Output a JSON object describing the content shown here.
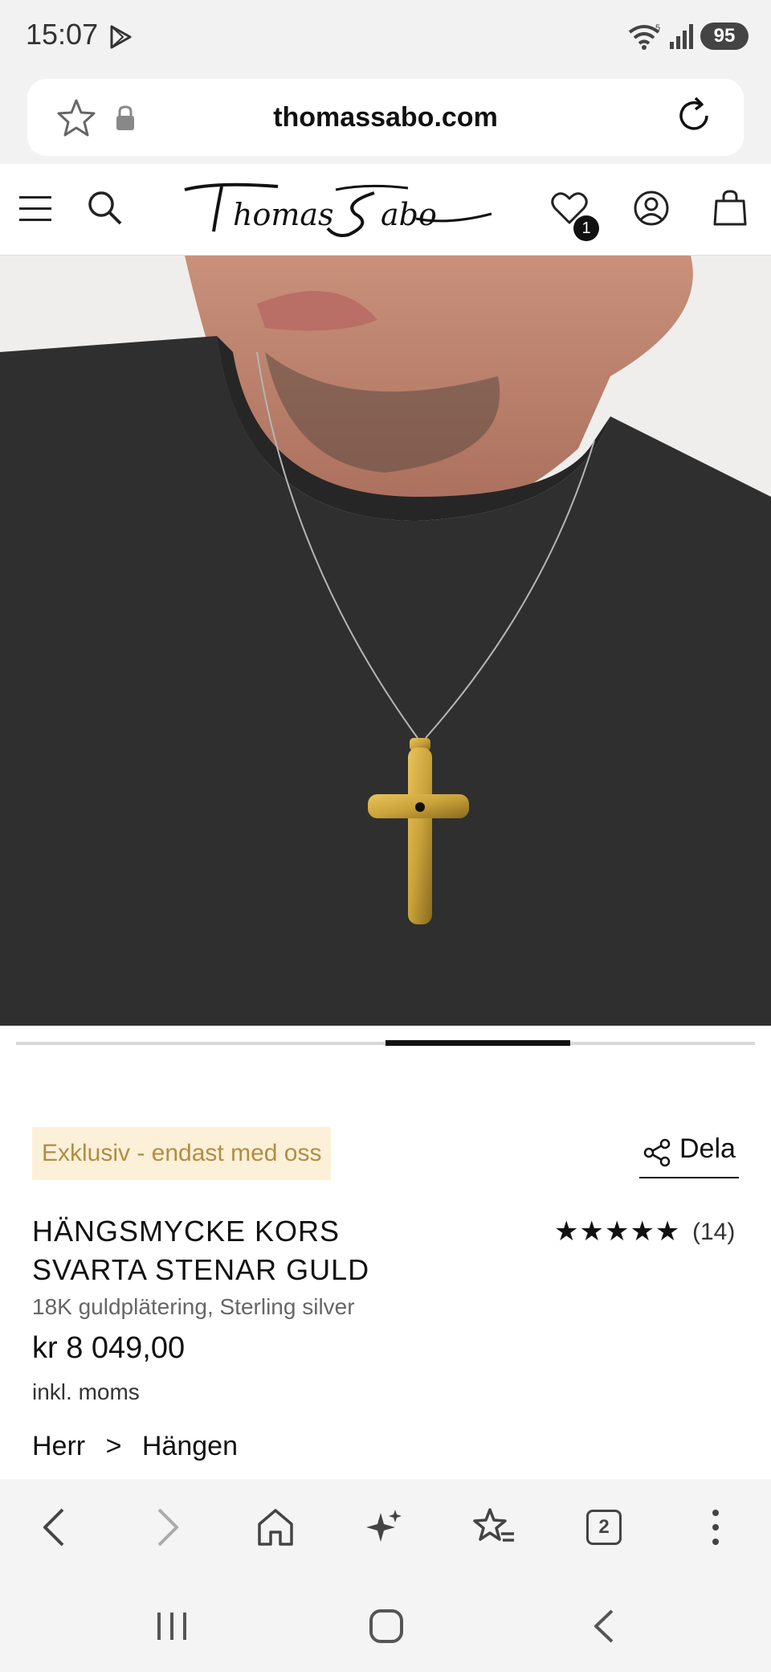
{
  "status_bar": {
    "time": "15:07",
    "battery": "95",
    "icons": [
      "play-store-icon",
      "wifi-icon",
      "signal-icon",
      "battery-icon"
    ]
  },
  "browser": {
    "url": "thomassabo.com",
    "tab_count": "2",
    "icons": [
      "bookmark-star-icon",
      "lock-icon",
      "reload-icon",
      "back-icon",
      "forward-icon",
      "home-icon",
      "assistant-sparkle-icon",
      "bookmarks-icon",
      "tabs-icon",
      "more-icon"
    ]
  },
  "site_header": {
    "logo_text": "Thomas Sabo",
    "wishlist_count": "1",
    "icons": [
      "menu-icon",
      "search-icon",
      "wishlist-heart-icon",
      "account-icon",
      "shopping-bag-icon"
    ]
  },
  "product": {
    "badge": "Exklusiv - endast med oss",
    "share_label": "Dela",
    "title_line1": "HÄNGSMYCKE KORS",
    "title_line2": "SVARTA STENAR GULD",
    "rating_stars": "★★★★★",
    "rating_value": 5,
    "rating_count": "(14)",
    "material": "18K guldplätering, Sterling silver",
    "price": "kr 8 049,00",
    "price_note": "inkl. moms",
    "breadcrumb": [
      "Herr",
      ">",
      "Hängen"
    ]
  },
  "carousel": {
    "active_index": 2,
    "total": 4
  },
  "colors": {
    "badge_bg": "#fdf0d8",
    "badge_text": "#b08d45",
    "shirt": "#2f2f2f",
    "gold": "#c9a23a"
  }
}
